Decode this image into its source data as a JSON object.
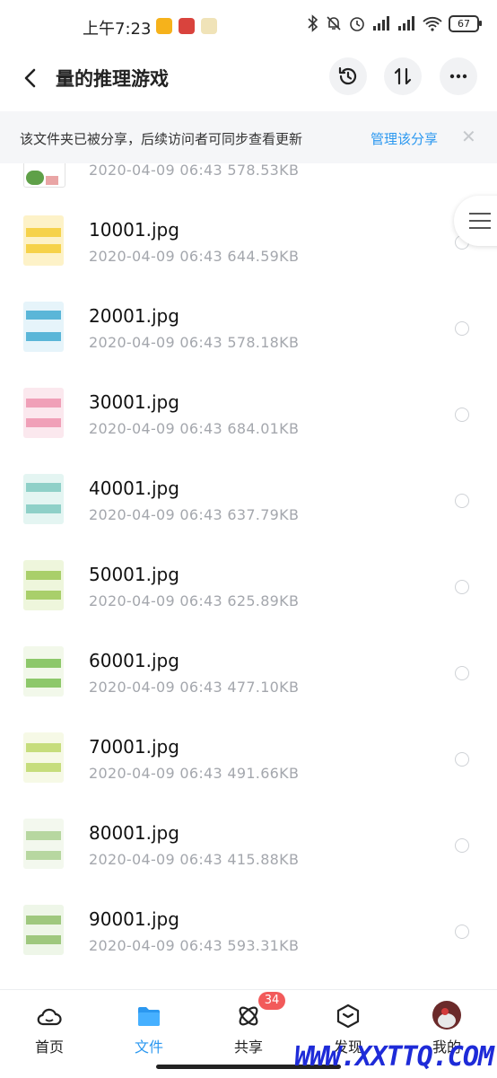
{
  "status": {
    "time": "上午7:23",
    "battery": "67",
    "app_colors": [
      "#f6b21b",
      "#d9433d",
      "#f0b640"
    ]
  },
  "header": {
    "back_icon": "chevron-left-icon",
    "title": "量的推理游戏",
    "actions": [
      "history-icon",
      "sort-icon",
      "more-icon"
    ]
  },
  "share_banner": {
    "text": "该文件夹已被分享，后续访问者可同步查看更新",
    "link": "管理该分享",
    "close": "✕"
  },
  "files": [
    {
      "name": "",
      "meta": "2020-04-09  06:43  578.53KB",
      "thumb_color": "#5fa048"
    },
    {
      "name": "10001.jpg",
      "meta": "2020-04-09  06:43  644.59KB",
      "thumb_color": "#f6d24a"
    },
    {
      "name": "20001.jpg",
      "meta": "2020-04-09  06:43  578.18KB",
      "thumb_color": "#5ab6d8"
    },
    {
      "name": "30001.jpg",
      "meta": "2020-04-09  06:43  684.01KB",
      "thumb_color": "#f0a0b8"
    },
    {
      "name": "40001.jpg",
      "meta": "2020-04-09  06:43  637.79KB",
      "thumb_color": "#8fd0c8"
    },
    {
      "name": "50001.jpg",
      "meta": "2020-04-09  06:43  625.89KB",
      "thumb_color": "#a9cf6a"
    },
    {
      "name": "60001.jpg",
      "meta": "2020-04-09  06:43  477.10KB",
      "thumb_color": "#8dc86a"
    },
    {
      "name": "70001.jpg",
      "meta": "2020-04-09  06:43  491.66KB",
      "thumb_color": "#c6dd7c"
    },
    {
      "name": "80001.jpg",
      "meta": "2020-04-09  06:43  415.88KB",
      "thumb_color": "#b7d7a0"
    },
    {
      "name": "90001.jpg",
      "meta": "2020-04-09  06:43  593.31KB",
      "thumb_color": "#9fc87e"
    }
  ],
  "tabs": [
    {
      "label": "首页",
      "icon": "cloud-icon"
    },
    {
      "label": "文件",
      "icon": "folder-icon",
      "active": true
    },
    {
      "label": "共享",
      "icon": "orbit-icon",
      "badge": "34"
    },
    {
      "label": "发现",
      "icon": "cube-icon"
    },
    {
      "label": "我的",
      "icon": "avatar"
    }
  ],
  "watermark": "WWW.XXTTQ.COM",
  "accent": "#2b98f0"
}
